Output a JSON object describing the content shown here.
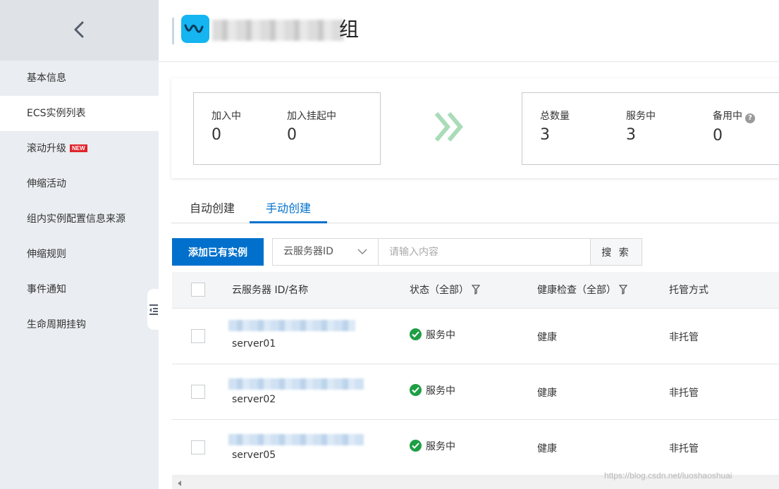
{
  "header": {
    "title_visible": "组"
  },
  "sidebar": {
    "items": [
      {
        "label": "基本信息"
      },
      {
        "label": "ECS实例列表"
      },
      {
        "label": "滚动升级",
        "badge": "NEW"
      },
      {
        "label": "伸缩活动"
      },
      {
        "label": "组内实例配置信息来源"
      },
      {
        "label": "伸缩规则"
      },
      {
        "label": "事件通知"
      },
      {
        "label": "生命周期挂钩"
      }
    ]
  },
  "stats": {
    "joining_label": "加入中",
    "joining_value": "0",
    "joining_pending_label": "加入挂起中",
    "joining_pending_value": "0",
    "total_label": "总数量",
    "total_value": "3",
    "in_service_label": "服务中",
    "in_service_value": "3",
    "standby_label": "备用中",
    "standby_value": "0",
    "help_glyph": "?"
  },
  "tabs": [
    {
      "label": "自动创建"
    },
    {
      "label": "手动创建"
    }
  ],
  "toolbar": {
    "add_label": "添加已有实例",
    "select_value": "云服务器ID",
    "search_placeholder": "请输入内容",
    "search_label": "搜 索"
  },
  "table": {
    "headers": {
      "id_name": "云服务器 ID/名称",
      "status": "状态（全部）",
      "health": "健康检查（全部）",
      "mode": "托管方式"
    },
    "rows": [
      {
        "name": "server01",
        "status": "服务中",
        "health": "健康",
        "mode": "非托管"
      },
      {
        "name": "server02",
        "status": "服务中",
        "health": "健康",
        "mode": "非托管"
      },
      {
        "name": "server05",
        "status": "服务中",
        "health": "健康",
        "mode": "非托管"
      }
    ]
  },
  "watermark": "https://blog.csdn.net/luoshaoshuai",
  "colors": {
    "accent": "#0070cc",
    "success": "#1e9e45",
    "new_badge": "#e0252c",
    "sidebar_bg": "#eaedf1",
    "logo": "#14b5f0"
  },
  "icons": {
    "back": "chevron-left-icon",
    "collapse": "sidebar-collapse-icon",
    "logo": "auto-scaling-logo-icon",
    "stats_arrow": "double-chevron-right-icon",
    "dropdown": "chevron-down-icon",
    "filter": "filter-funnel-icon",
    "status": "check-circle-icon",
    "scroll_left": "caret-left-icon"
  }
}
